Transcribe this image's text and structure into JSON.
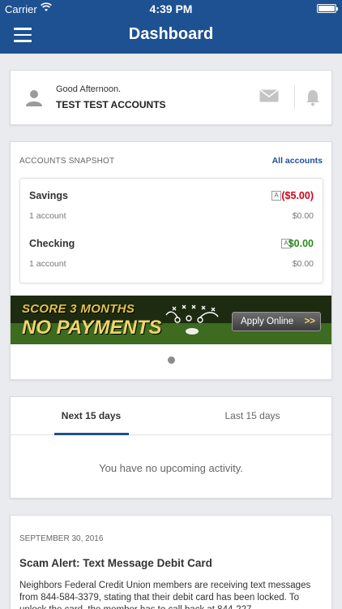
{
  "status_bar": {
    "carrier": "Carrier",
    "time": "4:39 PM"
  },
  "nav": {
    "title": "Dashboard"
  },
  "greeting": {
    "salutation": "Good Afternoon.",
    "name": "TEST TEST ACCOUNTS"
  },
  "snapshot": {
    "title": "ACCOUNTS SNAPSHOT",
    "all_accounts_link": "All accounts",
    "accounts": [
      {
        "name": "Savings",
        "count": "1 account",
        "badge": "A",
        "balance": "($5.00)",
        "available": "$0.00"
      },
      {
        "name": "Checking",
        "count": "1 account",
        "badge": "A",
        "balance": "$0.00",
        "available": "$0.00"
      }
    ],
    "banner": {
      "line1": "SCORE 3 MONTHS",
      "line2": "NO PAYMENTS",
      "button": "Apply Online"
    }
  },
  "activity": {
    "tabs": [
      "Next 15 days",
      "Last 15 days"
    ],
    "empty_message": "You have no upcoming activity."
  },
  "news": {
    "date": "SEPTEMBER 30, 2016",
    "headline": "Scam Alert: Text Message Debit Card",
    "body": "Neighbors Federal Credit Union members are receiving text messages from 844-584-3379, stating that their debit card has been locked. To unlock the card, the member has to call back at 844-227"
  },
  "colors": {
    "brand": "#1d5191",
    "negative": "#d0021b",
    "positive": "#2e8b1f"
  }
}
